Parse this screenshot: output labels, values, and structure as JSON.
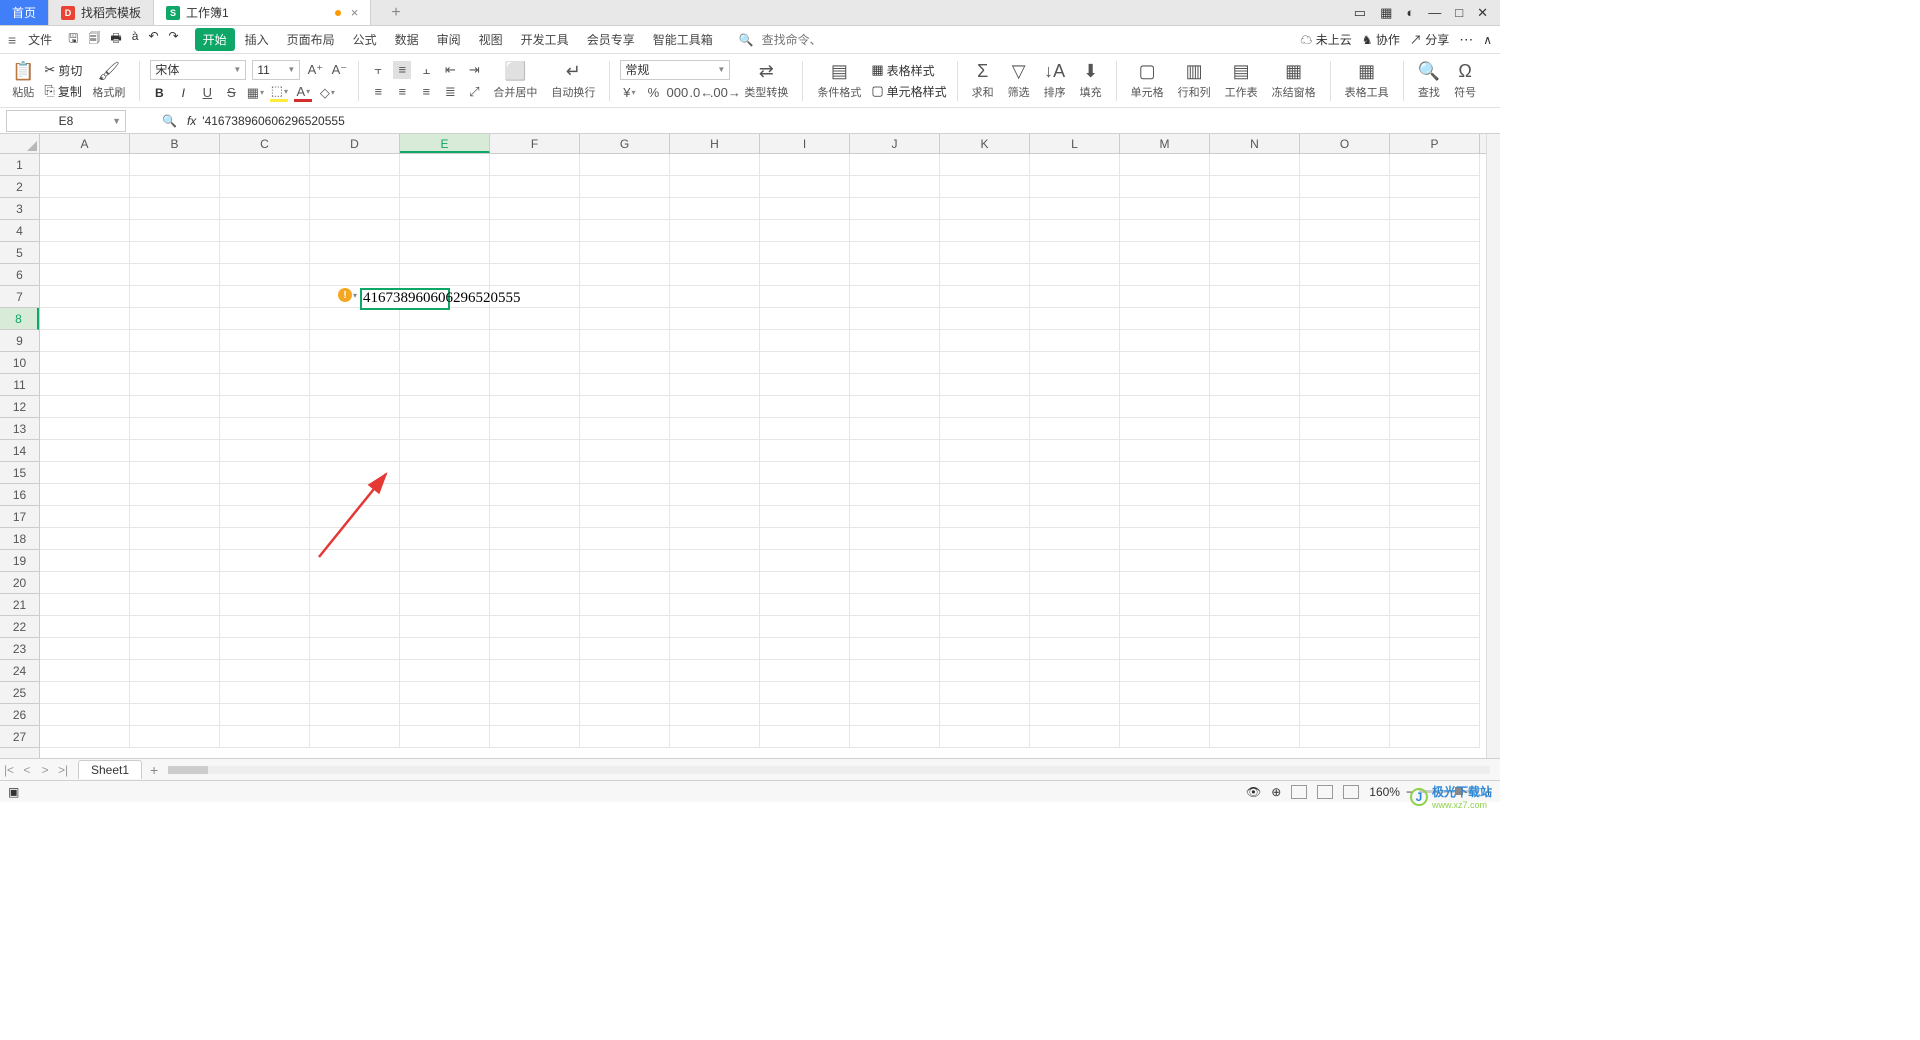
{
  "tabs": {
    "home": "首页",
    "docker": "找稻壳模板",
    "workbook": "工作簿1",
    "modified": true
  },
  "menu": {
    "file": "文件",
    "tabs": [
      "开始",
      "插入",
      "页面布局",
      "公式",
      "数据",
      "审阅",
      "视图",
      "开发工具",
      "会员专享",
      "智能工具箱"
    ],
    "activeTab": 0,
    "search_placeholder": "查找命令、搜索模板",
    "search_prefix": "Q"
  },
  "top_right": {
    "cloud": "未上云",
    "coop": "协作",
    "share": "分享"
  },
  "ribbon": {
    "paste": "粘贴",
    "cut": "剪切",
    "copy": "复制",
    "format_painter": "格式刷",
    "font_name": "宋体",
    "font_size": "11",
    "merge": "合并居中",
    "wrap": "自动换行",
    "numfmt": "常规",
    "type_convert": "类型转换",
    "cond": "条件格式",
    "cell_style": "单元格样式",
    "table_style": "表格样式",
    "sum": "求和",
    "filter": "筛选",
    "sort": "排序",
    "fill": "填充",
    "cell": "单元格",
    "rowcol": "行和列",
    "sheet": "工作表",
    "freeze": "冻结窗格",
    "tabletool": "表格工具",
    "find": "查找",
    "symbol": "符号"
  },
  "formula_bar": {
    "name_box": "E8",
    "fx_value": "'416738960606296520555"
  },
  "grid": {
    "columns": [
      "A",
      "B",
      "C",
      "D",
      "E",
      "F",
      "G",
      "H",
      "I",
      "J",
      "K",
      "L",
      "M",
      "N",
      "O",
      "P"
    ],
    "rows": [
      "1",
      "2",
      "3",
      "4",
      "5",
      "6",
      "7",
      "8",
      "9",
      "10",
      "11",
      "12",
      "13",
      "14",
      "15",
      "16",
      "17",
      "18",
      "19",
      "20",
      "21",
      "22",
      "23",
      "24",
      "25",
      "26",
      "27"
    ],
    "selected_col_index": 4,
    "selected_row_index": 7,
    "cell_value": "416738960606296520555"
  },
  "sheetbar": {
    "sheet_name": "Sheet1"
  },
  "statusbar": {
    "zoom": "160%"
  },
  "watermark": {
    "brand": "极光下载站",
    "url": "www.xz7.com"
  }
}
